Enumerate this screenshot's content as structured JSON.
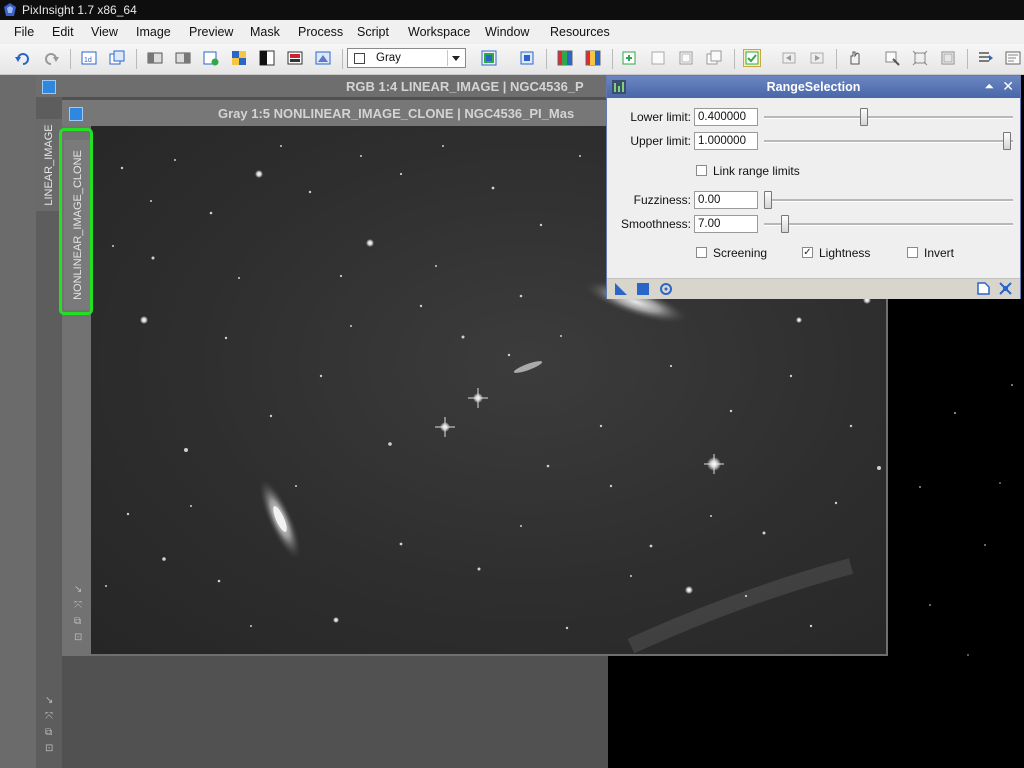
{
  "app": {
    "title": "PixInsight 1.7 x86_64"
  },
  "menu": [
    "File",
    "Edit",
    "View",
    "Image",
    "Preview",
    "Mask",
    "Process",
    "Script",
    "Workspace",
    "Window",
    "Resources"
  ],
  "toolbar": {
    "channel_select": "Gray"
  },
  "windows": {
    "linear": {
      "title": "RGB 1:4 LINEAR_IMAGE | NGC4536_P",
      "tab_label": "LINEAR_IMAGE"
    },
    "nonlinear": {
      "title": "Gray 1:5 NONLINEAR_IMAGE_CLONE | NGC4536_PI_Mas",
      "tab_label": "NONLINEAR_IMAGE_CLONE"
    }
  },
  "range_selection": {
    "title": "RangeSelection",
    "lower_label": "Lower limit:",
    "lower_value": "0.400000",
    "upper_label": "Upper limit:",
    "upper_value": "1.000000",
    "link_label": "Link range limits",
    "link_checked": false,
    "fuzziness_label": "Fuzziness:",
    "fuzziness_value": "0.00",
    "smoothness_label": "Smoothness:",
    "smoothness_value": "7.00",
    "screening_label": "Screening",
    "screening_checked": false,
    "lightness_label": "Lightness",
    "lightness_checked": true,
    "invert_label": "Invert",
    "invert_checked": false
  },
  "colors": {
    "accent": "#4966a8",
    "highlight": "#22e022",
    "background": "#000000"
  }
}
